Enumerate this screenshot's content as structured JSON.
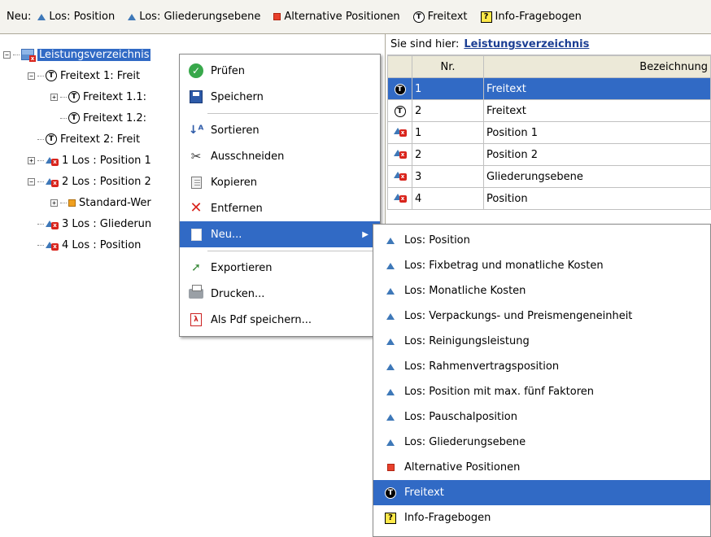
{
  "toolbar": {
    "label": "Neu:",
    "items": [
      {
        "icon": "triangle-blue-icon",
        "label": "Los: Position"
      },
      {
        "icon": "triangle-blue-icon",
        "label": "Los: Gliederungsebene"
      },
      {
        "icon": "square-red-icon",
        "label": "Alternative Positionen"
      },
      {
        "icon": "freitext-t-icon",
        "label": "Freitext"
      },
      {
        "icon": "info-question-icon",
        "label": "Info-Fragebogen"
      }
    ]
  },
  "tree": {
    "root": "Leistungsverzeichnis",
    "items": [
      "Freitext 1:  Freit",
      "Freitext 1.1:",
      "Freitext 1.2:",
      "Freitext 2:  Freit",
      "1 Los : Position 1",
      "2 Los : Position 2",
      "Standard-Wer",
      "3 Los : Gliederun",
      "4 Los : Position"
    ]
  },
  "grid": {
    "breadcrumb_label": "Sie sind hier:",
    "breadcrumb_link": "Leistungsverzeichnis",
    "columns": {
      "nr": "Nr.",
      "bezeichnung": "Bezeichnung"
    },
    "rows": [
      {
        "nr": "1",
        "bez": "Freitext"
      },
      {
        "nr": "2",
        "bez": "Freitext"
      },
      {
        "nr": "1",
        "bez": "Position 1"
      },
      {
        "nr": "2",
        "bez": "Position 2"
      },
      {
        "nr": "3",
        "bez": "Gliederungsebene"
      },
      {
        "nr": "4",
        "bez": "Position"
      }
    ]
  },
  "context_menu": {
    "items": [
      {
        "icon": "check-icon",
        "label": "Prüfen"
      },
      {
        "icon": "floppy-disk-icon",
        "label": "Speichern"
      },
      {
        "icon": "sort-icon",
        "label": "Sortieren"
      },
      {
        "icon": "scissors-icon",
        "label": "Ausschneiden"
      },
      {
        "icon": "copy-icon",
        "label": "Kopieren"
      },
      {
        "icon": "delete-x-icon",
        "label": "Entfernen"
      },
      {
        "icon": "new-page-icon",
        "label": "Neu..."
      },
      {
        "icon": "export-icon",
        "label": "Exportieren"
      },
      {
        "icon": "printer-icon",
        "label": "Drucken..."
      },
      {
        "icon": "pdf-icon",
        "label": "Als Pdf speichern..."
      }
    ]
  },
  "submenu": {
    "items": [
      {
        "icon": "triangle-blue-icon",
        "label": "Los: Position"
      },
      {
        "icon": "triangle-blue-icon",
        "label": "Los: Fixbetrag und monatliche Kosten"
      },
      {
        "icon": "triangle-blue-icon",
        "label": "Los: Monatliche Kosten"
      },
      {
        "icon": "triangle-blue-icon",
        "label": "Los: Verpackungs- und Preismengeneinheit"
      },
      {
        "icon": "triangle-blue-icon",
        "label": "Los: Reinigungsleistung"
      },
      {
        "icon": "triangle-blue-icon",
        "label": "Los: Rahmenvertragsposition"
      },
      {
        "icon": "triangle-blue-icon",
        "label": "Los: Position mit max. fünf Faktoren"
      },
      {
        "icon": "triangle-blue-icon",
        "label": "Los: Pauschalposition"
      },
      {
        "icon": "triangle-blue-icon",
        "label": "Los: Gliederungsebene"
      },
      {
        "icon": "square-red-icon",
        "label": "Alternative Positionen"
      },
      {
        "icon": "freitext-t-icon",
        "label": "Freitext"
      },
      {
        "icon": "info-question-icon",
        "label": "Info-Fragebogen"
      }
    ]
  },
  "colors": {
    "selection": "#316ac5",
    "toolbar_bg": "#f4f3ee",
    "accent_blue": "#3e78b8",
    "accent_red": "#e8402c"
  }
}
